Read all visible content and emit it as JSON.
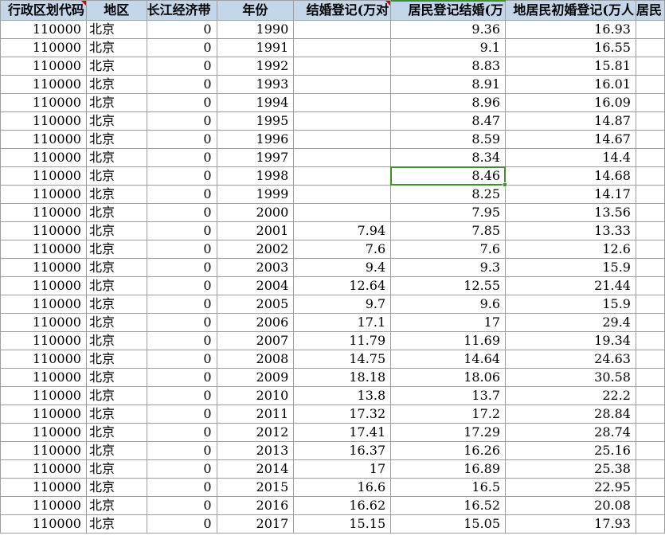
{
  "sheet": {
    "headers": [
      "行政区划代码",
      "地区",
      "长江经济带",
      "年份",
      "结婚登记(万对)",
      "居民登记结婚(万对)",
      "内地居民初婚登记(万人)",
      "居民"
    ],
    "header_visible": [
      "行政区划代码",
      "地区",
      "长江经济带",
      "年份",
      "结婚登记(万对",
      "居民登记结婚(万",
      "地居民初婚登记(万人",
      "居民"
    ],
    "rows": [
      [
        "110000",
        "北京",
        "0",
        "1990",
        "",
        "9.36",
        "16.93"
      ],
      [
        "110000",
        "北京",
        "0",
        "1991",
        "",
        "9.1",
        "16.55"
      ],
      [
        "110000",
        "北京",
        "0",
        "1992",
        "",
        "8.83",
        "15.81"
      ],
      [
        "110000",
        "北京",
        "0",
        "1993",
        "",
        "8.91",
        "16.01"
      ],
      [
        "110000",
        "北京",
        "0",
        "1994",
        "",
        "8.96",
        "16.09"
      ],
      [
        "110000",
        "北京",
        "0",
        "1995",
        "",
        "8.47",
        "14.87"
      ],
      [
        "110000",
        "北京",
        "0",
        "1996",
        "",
        "8.59",
        "14.67"
      ],
      [
        "110000",
        "北京",
        "0",
        "1997",
        "",
        "8.34",
        "14.4"
      ],
      [
        "110000",
        "北京",
        "0",
        "1998",
        "",
        "8.46",
        "14.68"
      ],
      [
        "110000",
        "北京",
        "0",
        "1999",
        "",
        "8.25",
        "14.17"
      ],
      [
        "110000",
        "北京",
        "0",
        "2000",
        "",
        "7.95",
        "13.56"
      ],
      [
        "110000",
        "北京",
        "0",
        "2001",
        "7.94",
        "7.85",
        "13.33"
      ],
      [
        "110000",
        "北京",
        "0",
        "2002",
        "7.6",
        "7.6",
        "12.6"
      ],
      [
        "110000",
        "北京",
        "0",
        "2003",
        "9.4",
        "9.3",
        "15.9"
      ],
      [
        "110000",
        "北京",
        "0",
        "2004",
        "12.64",
        "12.55",
        "21.44"
      ],
      [
        "110000",
        "北京",
        "0",
        "2005",
        "9.7",
        "9.6",
        "15.9"
      ],
      [
        "110000",
        "北京",
        "0",
        "2006",
        "17.1",
        "17",
        "29.4"
      ],
      [
        "110000",
        "北京",
        "0",
        "2007",
        "11.79",
        "11.69",
        "19.34"
      ],
      [
        "110000",
        "北京",
        "0",
        "2008",
        "14.75",
        "14.64",
        "24.63"
      ],
      [
        "110000",
        "北京",
        "0",
        "2009",
        "18.18",
        "18.06",
        "30.58"
      ],
      [
        "110000",
        "北京",
        "0",
        "2010",
        "13.8",
        "13.7",
        "22.2"
      ],
      [
        "110000",
        "北京",
        "0",
        "2011",
        "17.32",
        "17.2",
        "28.84"
      ],
      [
        "110000",
        "北京",
        "0",
        "2012",
        "17.41",
        "17.29",
        "28.74"
      ],
      [
        "110000",
        "北京",
        "0",
        "2013",
        "16.37",
        "16.26",
        "25.16"
      ],
      [
        "110000",
        "北京",
        "0",
        "2014",
        "17",
        "16.89",
        "25.38"
      ],
      [
        "110000",
        "北京",
        "0",
        "2015",
        "16.6",
        "16.5",
        "22.95"
      ],
      [
        "110000",
        "北京",
        "0",
        "2016",
        "16.62",
        "16.52",
        "20.08"
      ],
      [
        "110000",
        "北京",
        "0",
        "2017",
        "15.15",
        "15.05",
        "17.93"
      ]
    ],
    "selected_cell": {
      "row": 8,
      "col": 5
    },
    "colors": {
      "header_bg": "#c4d7ea",
      "grid_line": "#9e9e9e",
      "selection": "#3f8f2c",
      "comment_flag": "#d00000"
    }
  }
}
